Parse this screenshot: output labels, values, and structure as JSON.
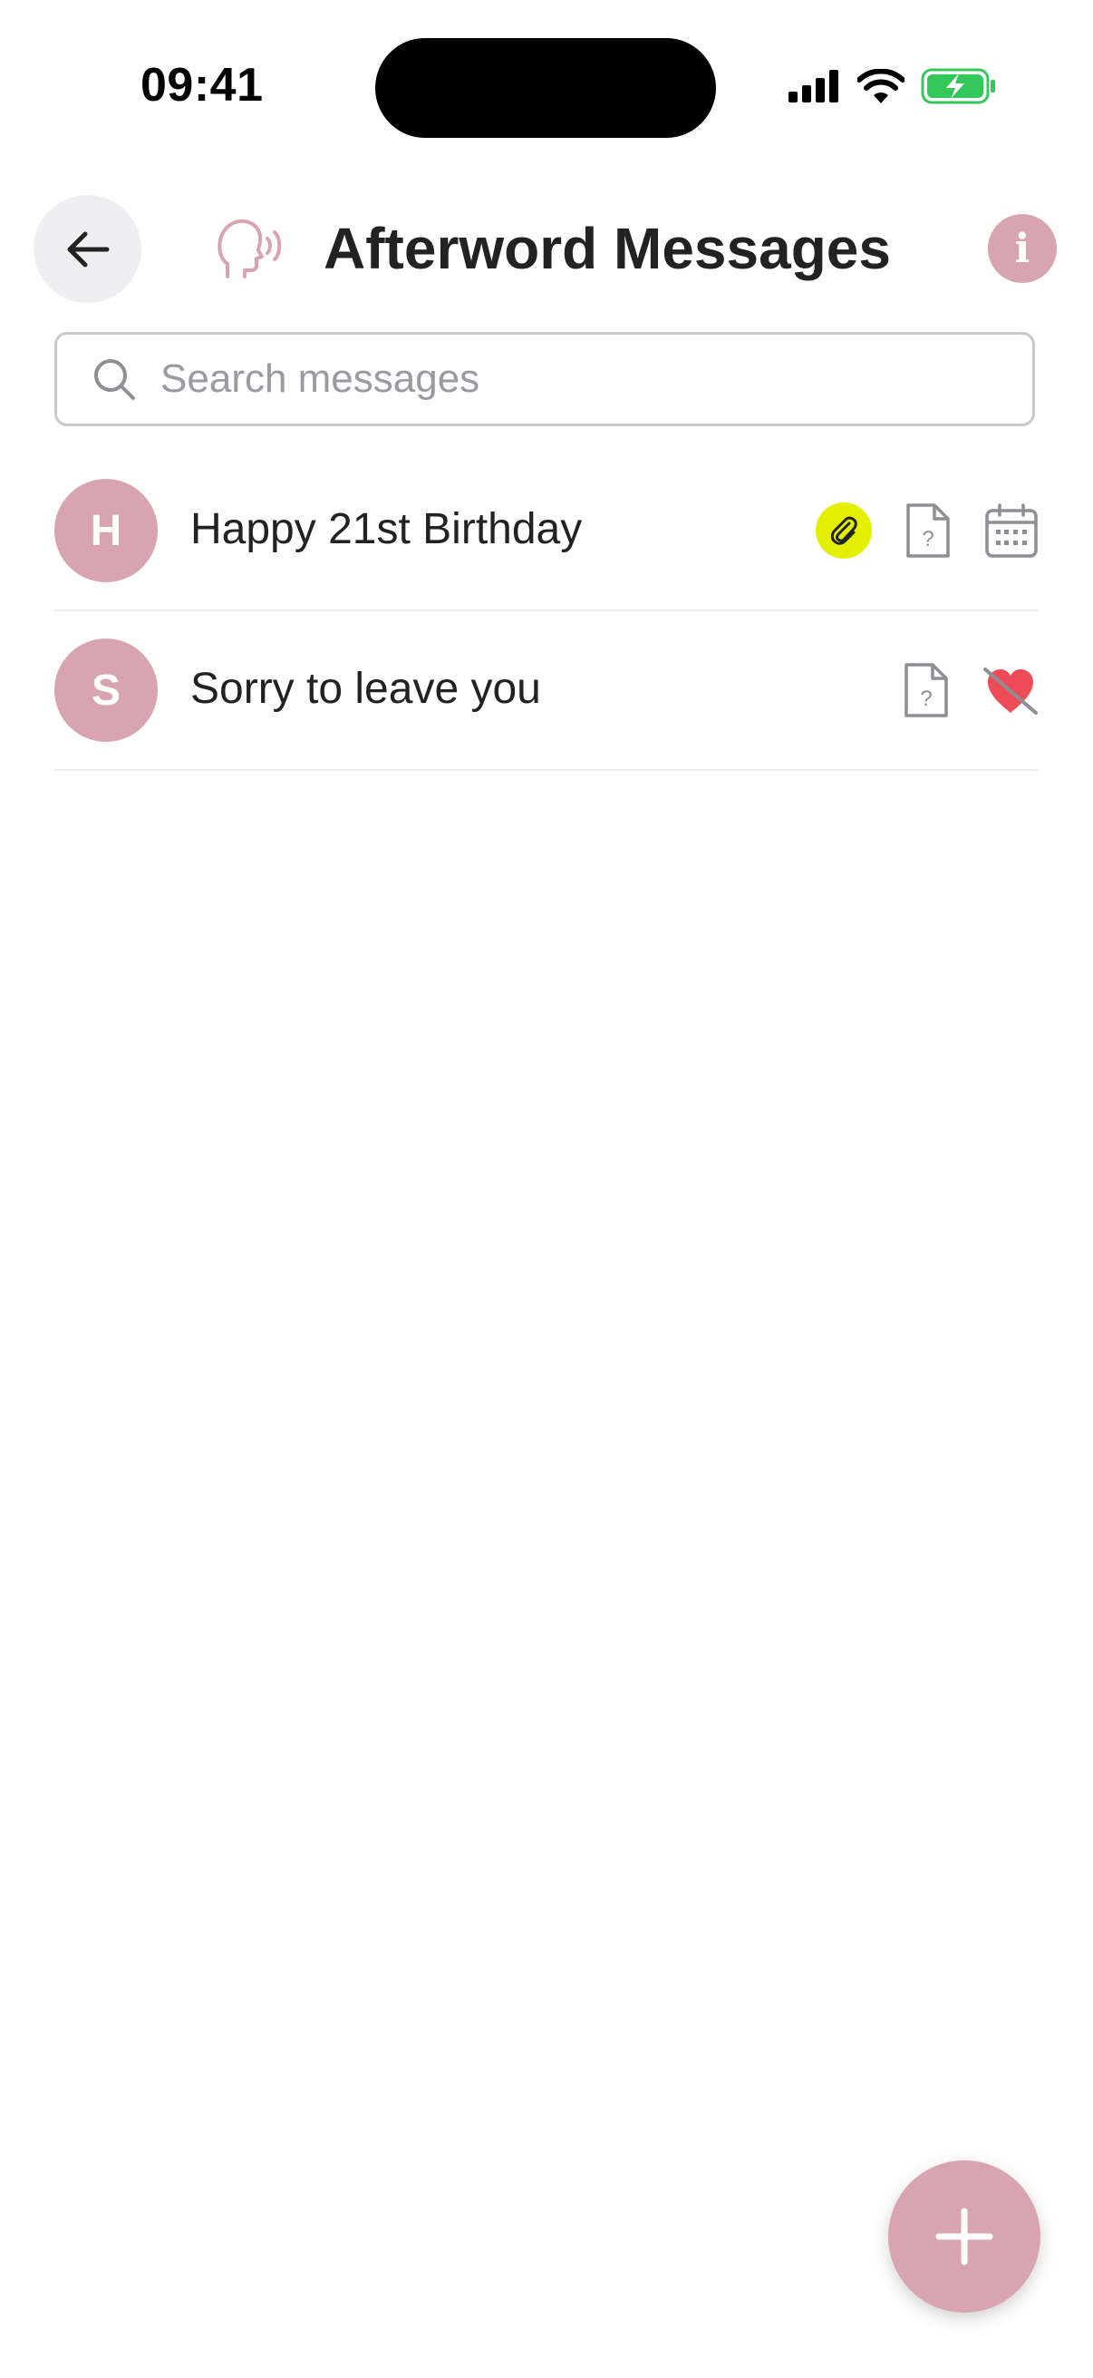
{
  "status_bar": {
    "time": "09:41",
    "icons": [
      "signal-icon",
      "wifi-icon",
      "battery-charging-icon"
    ]
  },
  "header": {
    "back_icon": "arrow-left-icon",
    "logo_icon": "speaking-head-icon",
    "title": "Afterword Messages",
    "info_label": "i"
  },
  "search": {
    "placeholder": "Search messages",
    "value": ""
  },
  "messages": [
    {
      "initial": "H",
      "title": "Happy 21st Birthday",
      "icons": [
        "paperclip-icon",
        "unknown-document-icon",
        "calendar-icon"
      ]
    },
    {
      "initial": "S",
      "title": "Sorry to leave you",
      "icons": [
        "unknown-document-icon",
        "heart-crossed-icon"
      ]
    }
  ],
  "fab": {
    "icon": "plus-icon"
  },
  "colors": {
    "accent": "#d9a4b1",
    "attachment_highlight": "#e4f000",
    "battery": "#34c759",
    "heart": "#ee4b59"
  }
}
